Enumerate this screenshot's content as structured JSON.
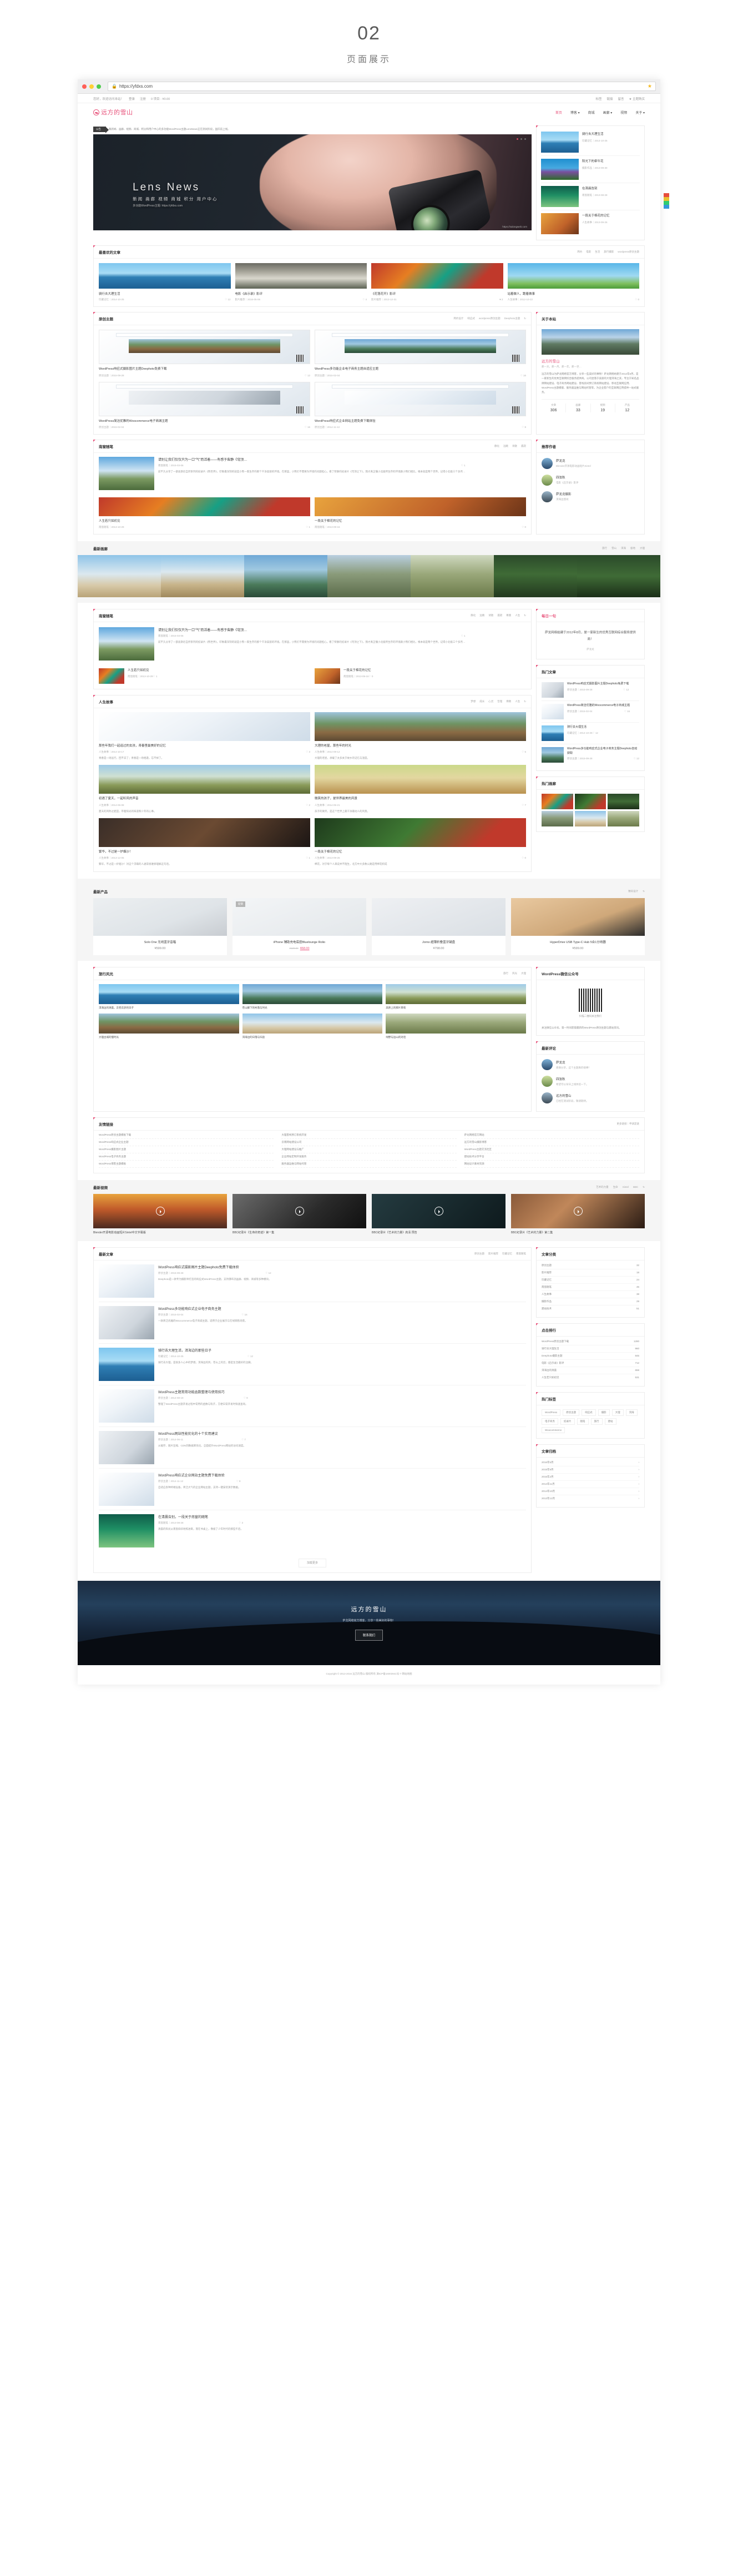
{
  "page": {
    "number": "02",
    "subtitle": "页面展示"
  },
  "browser": {
    "url": "https://yfdxs.com",
    "lock_icon": "lock-icon",
    "star_icon": "star-icon"
  },
  "topbar": {
    "greeting": "您好，欢迎访问本站！",
    "login": "登录",
    "register": "注册",
    "cart": "0 项目 - ¥0.00",
    "links": [
      "标签",
      "链接",
      "留言"
    ],
    "hot": "★ 主题购买"
  },
  "site": {
    "logo": "远方的雪山",
    "nav": [
      "首页",
      "博客 ▾",
      "商城",
      "画廊 ▾",
      "视频",
      "关于 ▾"
    ]
  },
  "notice": {
    "tag": "公告",
    "text": "集新闻、画廊、视频、商城、积分和用户中心的多功能WordPress主题LensNews正在测试阶段，国庆前上线。"
  },
  "hero": {
    "title": "Lens News",
    "subtitle": "新闻 画廊 视频 商城 积分 用户中心",
    "tagline": "多功能WordPress主题: https://yfdxs.com",
    "watermark": "https://salongweb.com"
  },
  "hero_side": {
    "items": [
      {
        "title": "骑行去大理生活",
        "meta": "珍藏记忆｜2014-10-25",
        "img": "ph-lake"
      },
      {
        "title": "阳光下的牵牛花",
        "meta": "摄影作品｜2013-09-30",
        "img": "ph-morning"
      },
      {
        "title": "在清晨告别",
        "meta": "南窗随笔｜2013-08-28",
        "img": "ph-green"
      },
      {
        "title": "一段关于棉花的记忆",
        "meta": "人生故事｜2013-09-26",
        "img": "ph-warm"
      }
    ]
  },
  "favorites": {
    "title": "最喜欢的文章",
    "tabs": [
      "简约",
      "电影",
      "生活",
      "旅行摄影",
      "wordpress原创主题"
    ],
    "items": [
      {
        "title": "骑行去大理生活",
        "meta": "珍藏记忆｜2014-10-25",
        "likes": "♡ 12",
        "img": "ph-lake"
      },
      {
        "title": "电影《启示录》影评",
        "meta": "影片推荐｜2016-05-06",
        "likes": "♡ 4",
        "img": "ph-falls"
      },
      {
        "title": "《花落花开》影评",
        "meta": "影片推荐｜2013-12-31",
        "likes": "♥ 2",
        "img": "ph-floral"
      },
      {
        "title": "站着做人，跪着做事",
        "meta": "人生故事｜2012-10-22",
        "likes": "♡ 0",
        "img": "ph-dande"
      }
    ]
  },
  "themes": {
    "title": "原创主题",
    "tabs": [
      "简约设计",
      "响应式",
      "wordpress原创主题",
      "Deephoto主题"
    ],
    "items": [
      {
        "title": "WordPress响应式摄影图片主题Deephoto免费下载",
        "meta": "原创主题｜2015-09-28",
        "likes": "♡ 12"
      },
      {
        "title": "WordPress多功能企业电子商务主题自适应主题",
        "meta": "原创主题｜2015-02-04",
        "likes": "♡ 16"
      },
      {
        "title": "WordPress简洁优雅的Woocommerce电子商城主题",
        "meta": "原创主题｜2015-02-04",
        "likes": "♡ 16"
      },
      {
        "title": "WordPress响应式企业网站主题免费下载体验",
        "meta": "原创主题｜2014-11-12",
        "likes": "♡ 8"
      }
    ]
  },
  "about": {
    "title": "关于本站",
    "name": "远方的雪山",
    "slogan": "那一天，那一月，那一年，那一世…",
    "text": "远方的雪山为萨龙网络官方博客，分享一些美好的事物！萨龙网络始建于2012年8月，是一家新生的优秀互联网综合服务提供商。公司坐落于美丽的大理洱海之滨，专注于知名品牌网站建设、电子商务网站建设、客栈房间预订系统网站建设、移动互联网应用、WordPress主题模版、服务器运维与网站托管等，为企业客户的互联网应用提供一站式服务。",
    "stats": [
      {
        "k": "文章",
        "v": "306"
      },
      {
        "k": "画廊",
        "v": "33"
      },
      {
        "k": "视频",
        "v": "19"
      },
      {
        "k": "产品",
        "v": "12"
      }
    ]
  },
  "authors": {
    "title": "推荐作者",
    "items": [
      {
        "name": "萨龙龙",
        "desc": "Blender开源电影动画短片Sintel",
        "avatar": "av1"
      },
      {
        "name": "四弦秋",
        "desc": "电影《启示录》影评",
        "avatar": "av2"
      },
      {
        "name": "萨龙龙摄影",
        "desc": "洱海边悠闲",
        "avatar": "av3"
      }
    ]
  },
  "gallery_band": {
    "title": "最新画廊",
    "tabs": [
      "旅行",
      "雪山",
      "洱海",
      "极地",
      "大理"
    ],
    "images": [
      "ph-beach",
      "ph-gal1",
      "ph-gal2",
      "ph-gal3",
      "ph-gal4",
      "ph-tent",
      "ph-gal5"
    ]
  },
  "essays": {
    "title": "南窗随笔",
    "tabs": [
      "静化",
      "远眺",
      "诗歌",
      "孤寂",
      "尊重",
      "人生"
    ],
    "lead": {
      "title": "请别让我们仅仅只为一口\"气\"而活着——有感于柴静《穹顶…",
      "meta": "南窗随笔｜2015-03-06",
      "likes": "♡ 1",
      "excerpt": "前不久分享了一部迪斯尼自然系列的纪录片《熊世界》，印象最深刻的就是小熊一家生存的那个干净美丽的环境。在那里，小熊们不需要为环境的问题担心。看了柴静的纪录片《穹顶之下》，我才真正懂小北极所生存的环境跟小熊们相比，根本就是两个世界。记得小北极三个多月…",
      "img": "ph-sky"
    },
    "small": [
      {
        "title": "人生若只如初见",
        "meta": "南窗随笔｜2013-10-29",
        "likes": "♡ 1",
        "img": "ph-floral"
      },
      {
        "title": "一段关于棉花的记忆",
        "meta": "南窗随笔｜2013-09-16",
        "likes": "♡ 0",
        "img": "ph-warm"
      }
    ]
  },
  "daily": {
    "title": "每日一句",
    "quote": "萨龙网络始建于2012年8月，是一家新生的优秀互联网综合服务提供商！",
    "author": "萨龙龙"
  },
  "hot_rail": {
    "title": "热门文章",
    "items": [
      {
        "title": "WordPress响应式摄影图片主题Deephoto免费下载",
        "meta": "原创主题｜2015-09-28",
        "likes": "♡ 12",
        "img": "ph-desk"
      },
      {
        "title": "WordPress简洁优雅的Woocommerce电子商城主题",
        "meta": "原创主题｜2015-02-04",
        "likes": "♡ 16",
        "img": "ph-uiblue"
      },
      {
        "title": "骑行去大理生活",
        "meta": "珍藏记忆｜2014-10-25",
        "likes": "♡ 12",
        "img": "ph-lake"
      },
      {
        "title": "WordPress多功能响应式企业电子商务主题Deephoto自动获取",
        "meta": "原创主题｜2015-09-28",
        "likes": "♡ 12",
        "img": "ph-gal2"
      }
    ]
  },
  "photo_rail": {
    "title": "热门画廊",
    "images": [
      "ph-floral",
      "ph-rose",
      "ph-gal5",
      "ph-gal3",
      "ph-beach",
      "ph-gal4"
    ]
  },
  "life": {
    "title": "人生故事",
    "tabs": [
      "梦想",
      "成长",
      "心灵",
      "哲理",
      "佛教",
      "人生"
    ],
    "items": [
      {
        "title": "那些年我们一起追过的女孩，青春里最美好的记忆",
        "meta": "人生故事｜2014-10-17",
        "likes": "♡ 3",
        "excerpt": "青春是一场远行，回不去了；青春是一场相逢，忘不掉了。",
        "img": "ph-uiblue"
      },
      {
        "title": "大理的老屋，那些年的时光",
        "meta": "人生故事｜2014-09-12",
        "likes": "♡ 5",
        "excerpt": "大理的老屋，承载了太多关于故乡的记忆与温度。",
        "img": "ph-temple"
      },
      {
        "title": "初遇了夏天，一起听风的声音",
        "meta": "人生故事｜2014-06-08",
        "likes": "♡ 2",
        "excerpt": "夏天的风吹过麦田，带着阳光的味道和少年的心事。",
        "img": "ph-field"
      },
      {
        "title": "微笑的孩子，是世界最美的风景",
        "meta": "人生故事｜2014-05-21",
        "likes": "♡ 7",
        "excerpt": "孩子的微笑，是这个世界上最干净最动人的风景。",
        "img": "ph-child"
      },
      {
        "title": "繁华，不过是一炉烟沙！",
        "meta": "人生故事｜2013-12-05",
        "likes": "♡ 1",
        "excerpt": "繁华，不过是一炉烟沙！对这个浮躁的人通常很难够理解这句话。",
        "img": "ph-room"
      },
      {
        "title": "一段关于棉花的记忆",
        "meta": "人生故事｜2013-09-26",
        "likes": "♡ 0",
        "excerpt": "棉花，对于每个人来说并不陌生，北方中大多数公路是用棉花织成",
        "img": "ph-rose"
      }
    ]
  },
  "products": {
    "title": "最新产品",
    "tabs": [
      "数码设计"
    ],
    "items": [
      {
        "title": "Solo One 无线蓝牙音箱",
        "price": "¥599.00",
        "img": "ph-prod1",
        "badge": ""
      },
      {
        "title": "iPhone 辅助充电底座Bluelounge Rolio",
        "price": "¥68.00",
        "old": "¥120.00",
        "img": "ph-prod2",
        "badge": "促销"
      },
      {
        "title": "Jorno 超薄折叠蓝牙键盘",
        "price": "¥798.00",
        "img": "ph-prod3",
        "badge": ""
      },
      {
        "title": "HyperDrive USB Type-C Hub 5合1分线器",
        "price": "¥599.00",
        "img": "ph-prod4",
        "badge": ""
      }
    ]
  },
  "pins": {
    "title": "旅行风光",
    "tabs": [
      "旅行",
      "风光",
      "大理"
    ],
    "items": [
      {
        "title": "洱海边的清晨，云卷云舒的日子",
        "img": "ph-lake"
      },
      {
        "title": "苍山脚下的村落与时光",
        "img": "ph-gal2"
      },
      {
        "title": "高原上的那片草甸",
        "img": "ph-field"
      },
      {
        "title": "大理古城的慢时光",
        "img": "ph-temple"
      },
      {
        "title": "洱海边的日落与归途",
        "img": "ph-beach"
      },
      {
        "title": "绿野与远山的对话",
        "img": "ph-gal4"
      }
    ]
  },
  "wechat": {
    "title": "WordPress微信公众号",
    "caption": "扫描二维码关注我们",
    "desc": "关注微信公众号，第一时间获取最新的WordPress原创主题与建站资讯。"
  },
  "comments_rail": {
    "title": "最新评论",
    "items": [
      {
        "name": "萨龙龙",
        "text": "感谢分享，这个主题真的很棒！",
        "avatar": "av1"
      },
      {
        "name": "四弦秋",
        "text": "希望可以早日上线体验一下。",
        "avatar": "av2"
      },
      {
        "name": "远方的雪山",
        "text": "已经在测试阶段，敬请期待。",
        "avatar": "av3"
      }
    ]
  },
  "friendlinks": {
    "title": "友情链接",
    "more": "更多链接｜申请友链",
    "cols": [
      [
        "WordPress原创主题模板下载",
        "WordPress响应式企业主题",
        "WordPress摄影图片主题",
        "WordPress电子商务主题",
        "WordPress博客主题模板"
      ],
      [
        "大理客栈预订系统开发",
        "云南网站建设公司",
        "大理网站建设与推广",
        "企业网站定制开发服务",
        "服务器运维与网站托管"
      ],
      [
        "萨龙网络官方网站",
        "远方的雪山摄影博客",
        "WordPress主题交流社区",
        "建站技术分享平台",
        "网站设计素材资源"
      ]
    ]
  },
  "videos": {
    "title": "最新视频",
    "tabs": [
      "艺术的力量",
      "生命",
      "Sintel",
      "BBC"
    ],
    "items": [
      {
        "title": "Blender开源电影动画短片Sintel中文字幕版",
        "img": "ph-vid1"
      },
      {
        "title": "BBC纪录片《生命的奇迹》第一集",
        "img": "ph-vid2"
      },
      {
        "title": "BBC纪录片《艺术的力量》高清 预告",
        "img": "ph-vid3"
      },
      {
        "title": "BBC纪录片《艺术的力量》第二集",
        "img": "ph-vid4"
      }
    ]
  },
  "blog": {
    "title": "最新文章",
    "tabs": [
      "原创主题",
      "影片推荐",
      "珍藏记忆",
      "南窗随笔"
    ],
    "items": [
      {
        "title": "WordPress响应式摄影图片主题Deephoto免费下载体验",
        "meta": "原创主题｜2015-09-28",
        "likes": "♡ 12",
        "excerpt": "Deephoto是一款专为摄影师打造的响应式WordPress主题，支持瀑布流画廊、视频、商城等多种模块。",
        "img": "ph-uiblue"
      },
      {
        "title": "WordPress多功能响应式企业电子商务主题",
        "meta": "原创主题｜2015-02-04",
        "likes": "♡ 16",
        "excerpt": "一款简洁优雅的Woocommerce电子商城主题，适用于企业展示与在线销售场景。",
        "img": "ph-desk"
      },
      {
        "title": "骑行去大理生活，洱海边的那些日子",
        "meta": "珍藏记忆｜2014-10-25",
        "likes": "♡ 12",
        "excerpt": "骑行去大理，是很多人心中的梦想。洱海边的风、苍山上的云，都是生活最好的注脚。",
        "img": "ph-lake"
      },
      {
        "title": "WordPress主题常用功能函数整理与使用技巧",
        "meta": "原创主题｜2014-08-19",
        "likes": "♡ 9",
        "excerpt": "整理了WordPress主题开发过程中常用的函数与钩子，方便日常开发时快速查询。",
        "img": "ph-uiblue"
      },
      {
        "title": "WordPress网站性能优化的十个实用建议",
        "meta": "原创主题｜2014-06-11",
        "likes": "♡ 7",
        "excerpt": "从缓存、图片压缩、CDN到数据库优化，全面提升WordPress网站的访问速度。",
        "img": "ph-desk"
      },
      {
        "title": "WordPress响应式企业网站主题免费下载体验",
        "meta": "原创主题｜2014-11-12",
        "likes": "♡ 8",
        "excerpt": "自适应各种终端设备，简洁大气的企业网站主题，支持一键安装演示数据。",
        "img": "ph-uiblue"
      },
      {
        "title": "在清晨告别，一段关于南窗的随笔",
        "meta": "南窗随笔｜2013-08-28",
        "likes": "♡ 3",
        "excerpt": "清晨的阳光从南窗斜斜地照进来，落在书桌上，像极了少年时代的那些午后。",
        "img": "ph-green"
      }
    ],
    "more": "加载更多"
  },
  "blog_rail": {
    "categories_title": "文章分类",
    "categories": [
      {
        "name": "原创主题",
        "count": "32"
      },
      {
        "name": "影片推荐",
        "count": "18"
      },
      {
        "name": "珍藏记忆",
        "count": "24"
      },
      {
        "name": "南窗随笔",
        "count": "46"
      },
      {
        "name": "人生故事",
        "count": "38"
      },
      {
        "name": "摄影作品",
        "count": "29"
      },
      {
        "name": "建站技术",
        "count": "51"
      }
    ],
    "ranking_title": "点击排行",
    "ranking": [
      {
        "name": "WordPress原创主题下载",
        "count": "1280"
      },
      {
        "name": "骑行去大理生活",
        "count": "960"
      },
      {
        "name": "Deephoto摄影主题",
        "count": "845"
      },
      {
        "name": "电影《启示录》影评",
        "count": "712"
      },
      {
        "name": "洱海边的清晨",
        "count": "658"
      },
      {
        "name": "人生若只如初见",
        "count": "531"
      }
    ],
    "tags_title": "热门标签",
    "tags": [
      "WordPress",
      "原创主题",
      "响应式",
      "摄影",
      "大理",
      "洱海",
      "电子商务",
      "纪录片",
      "随笔",
      "旅行",
      "建站",
      "Woocommerce"
    ],
    "archive_title": "文章归档",
    "archive": [
      "2016年5月",
      "2015年9月",
      "2015年2月",
      "2014年11月",
      "2014年10月",
      "2013年12月"
    ]
  },
  "footer": {
    "title": "远方的雪山",
    "slogan": "萨龙网络官方博客，分享一些美好的事物！",
    "button": "联系我们",
    "copyright": "Copyright © 2013-2016 远方的雪山 版权所有  滇ICP备16003941号-7  网站地图"
  }
}
